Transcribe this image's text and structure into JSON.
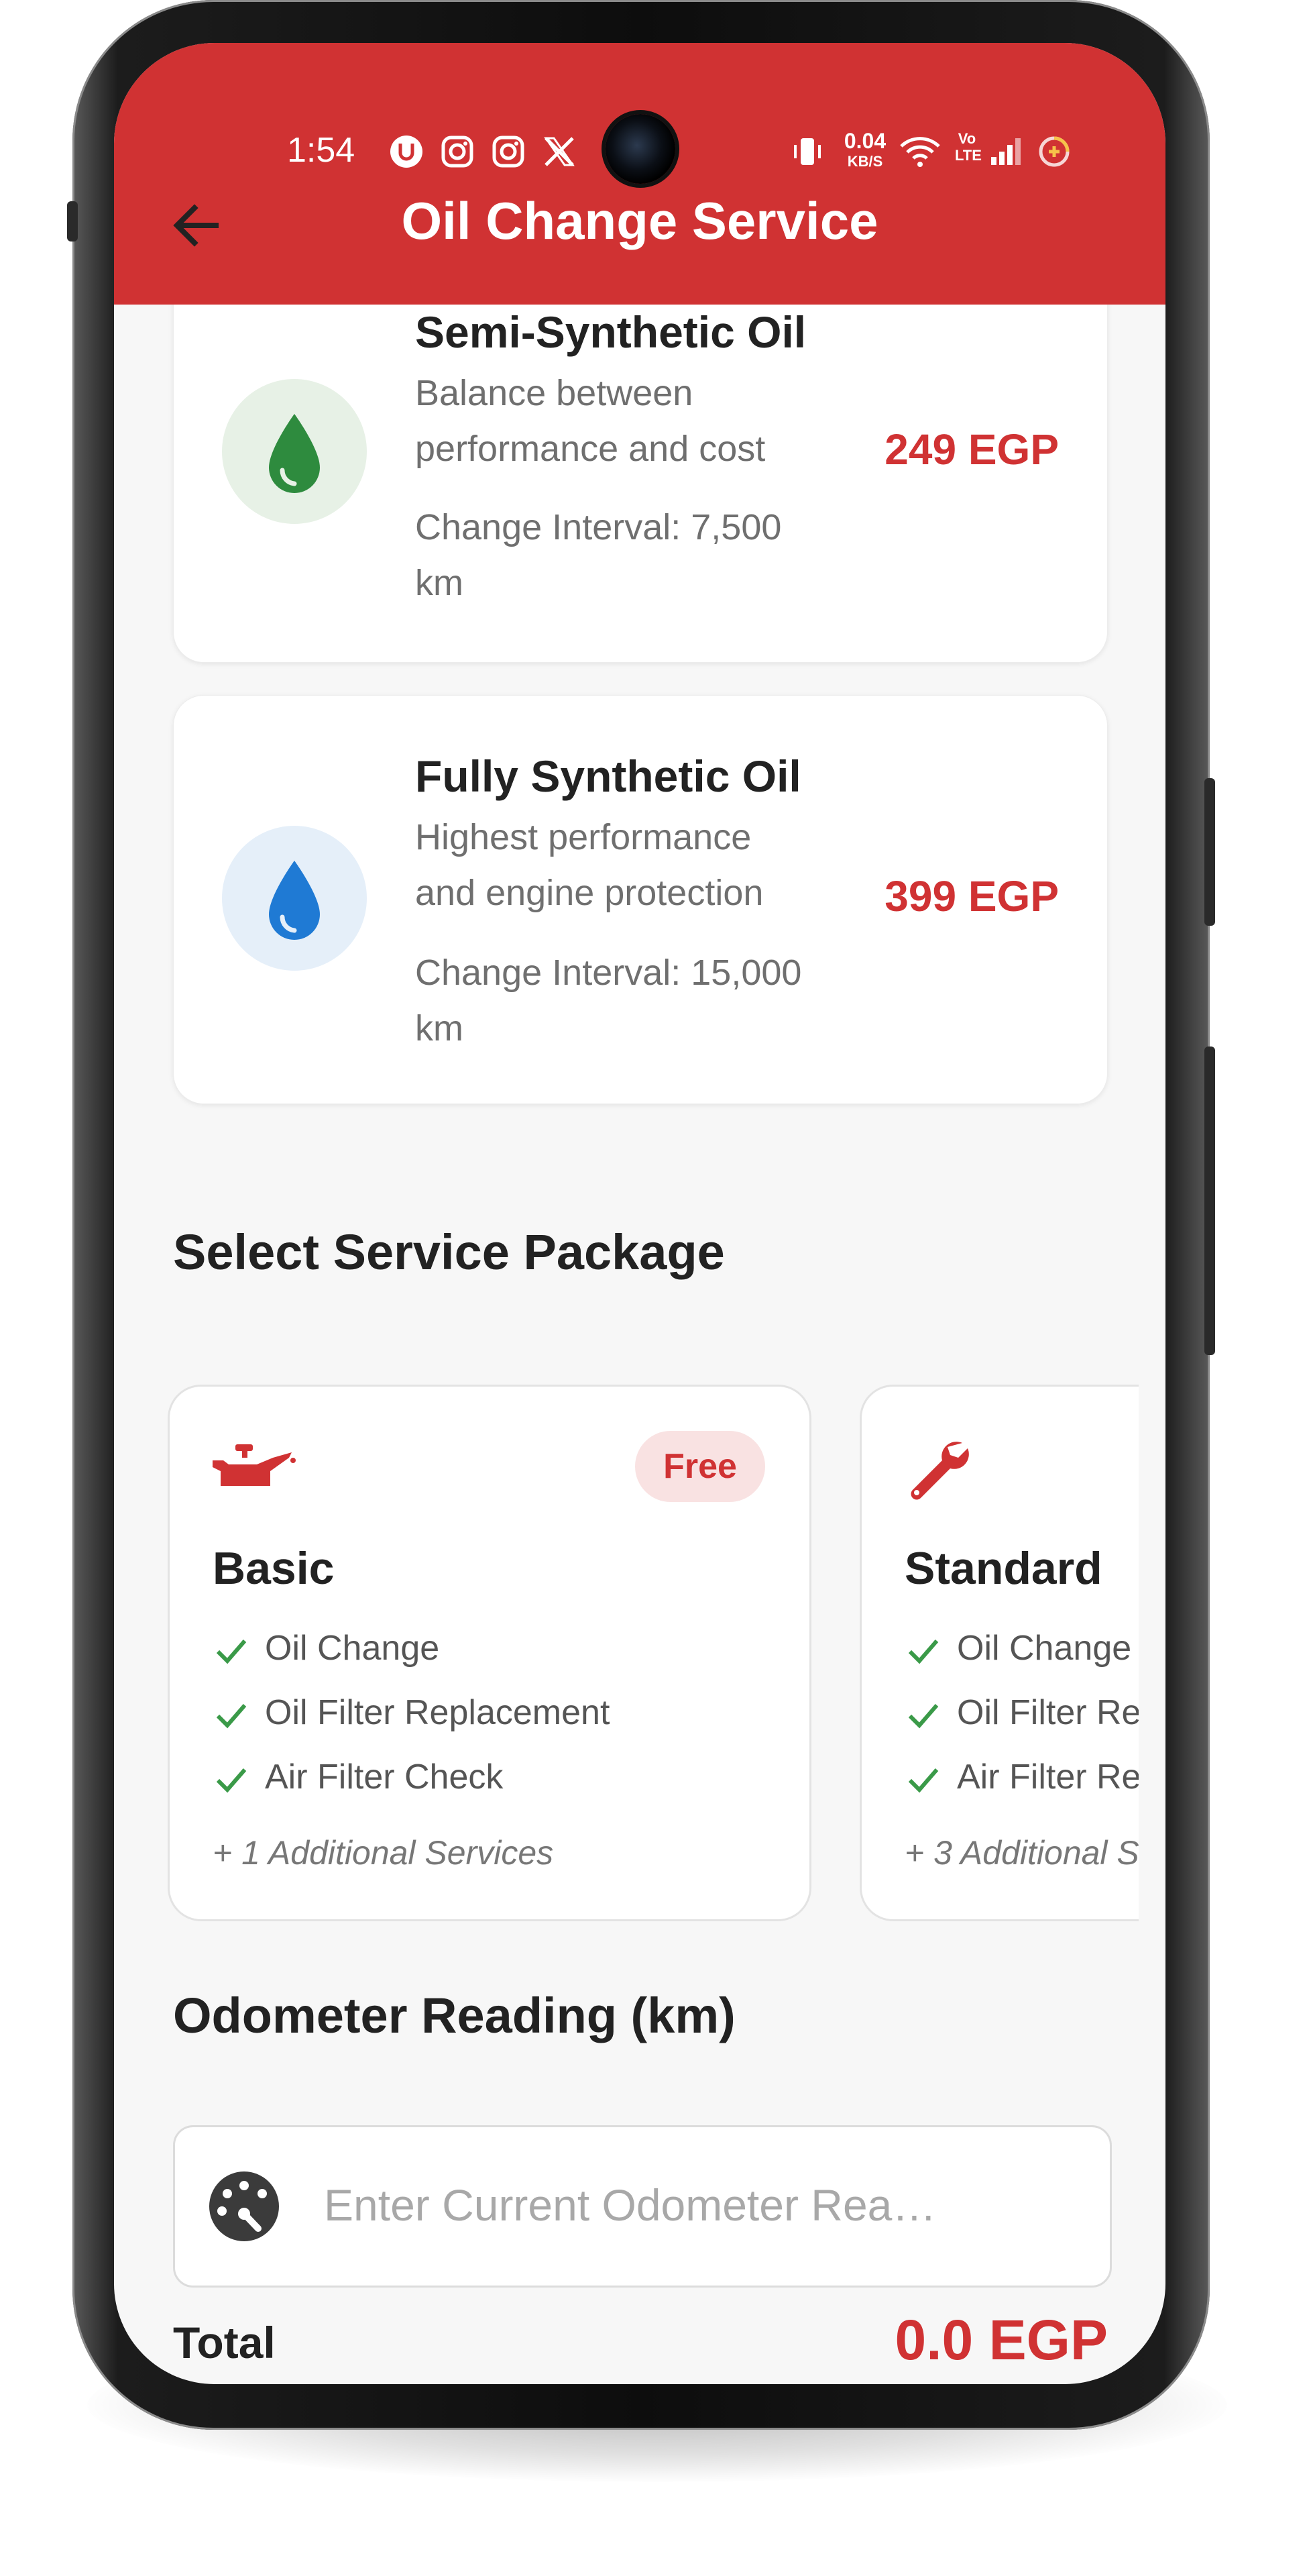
{
  "status_bar": {
    "time": "1:54",
    "net_speed": "0.04",
    "net_unit": "KB/S",
    "volte_top": "Vo",
    "volte_bottom": "LTE",
    "icons": [
      "u-app-icon",
      "instagram-icon",
      "instagram-icon",
      "x-icon",
      "vibrate-icon",
      "wifi-icon",
      "signal-icon",
      "battery-saver-icon"
    ]
  },
  "header": {
    "title": "Oil Change Service",
    "back_icon": "arrow-left-icon"
  },
  "oils": [
    {
      "name": "Semi-Synthetic Oil",
      "description": "Balance between performance and cost",
      "desc_line1": "Balance between",
      "desc_line2": "performance and cost",
      "interval_line1": "Change Interval: 7,500",
      "interval_line2": "km",
      "price": "249 EGP",
      "icon": "oil-drop-icon",
      "color": "#2e8b3e",
      "bg": "#e7f1e6"
    },
    {
      "name": "Fully Synthetic Oil",
      "desc_line1": "Highest performance",
      "desc_line2": "and engine protection",
      "interval_line1": "Change Interval: 15,000",
      "interval_line2": "km",
      "price": "399 EGP",
      "icon": "oil-drop-icon",
      "color": "#1f7ad4",
      "bg": "#e5eff9"
    }
  ],
  "packages_section": {
    "title": "Select Service Package"
  },
  "packages": [
    {
      "name": "Basic",
      "badge": "Free",
      "icon": "oil-can-icon",
      "features": [
        "Oil Change",
        "Oil Filter Replacement",
        "Air Filter Check"
      ],
      "more": "+ 1 Additional Services"
    },
    {
      "name": "Standard",
      "icon": "wrench-icon",
      "features": [
        "Oil Change",
        "Oil Filter Re",
        "Air Filter Re"
      ],
      "more": "+ 3 Additional S"
    }
  ],
  "odometer": {
    "title": "Odometer Reading (km)",
    "placeholder": "Enter Current Odometer Rea…",
    "icon": "speedometer-icon"
  },
  "total": {
    "label": "Total",
    "value": "0.0 EGP"
  },
  "colors": {
    "primary": "#d03233",
    "success": "#3a9a48"
  }
}
